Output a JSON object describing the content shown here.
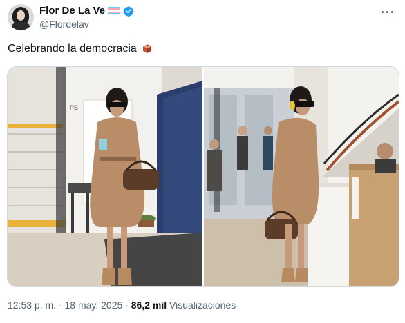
{
  "tweet": {
    "display_name": "Flor De La Ve",
    "handle": "@Flordelav",
    "text": "Celebrando la democracia",
    "time": "12:53 p. m.",
    "separator": "·",
    "date": "18 may. 2025",
    "views_count": "86,2 mil",
    "views_label": "Visualizaciones",
    "more_label": "···",
    "accent_color": "#1d9bf0"
  },
  "photos": [
    {
      "sign_label": "PB"
    },
    {
      "sign_label": ""
    }
  ]
}
